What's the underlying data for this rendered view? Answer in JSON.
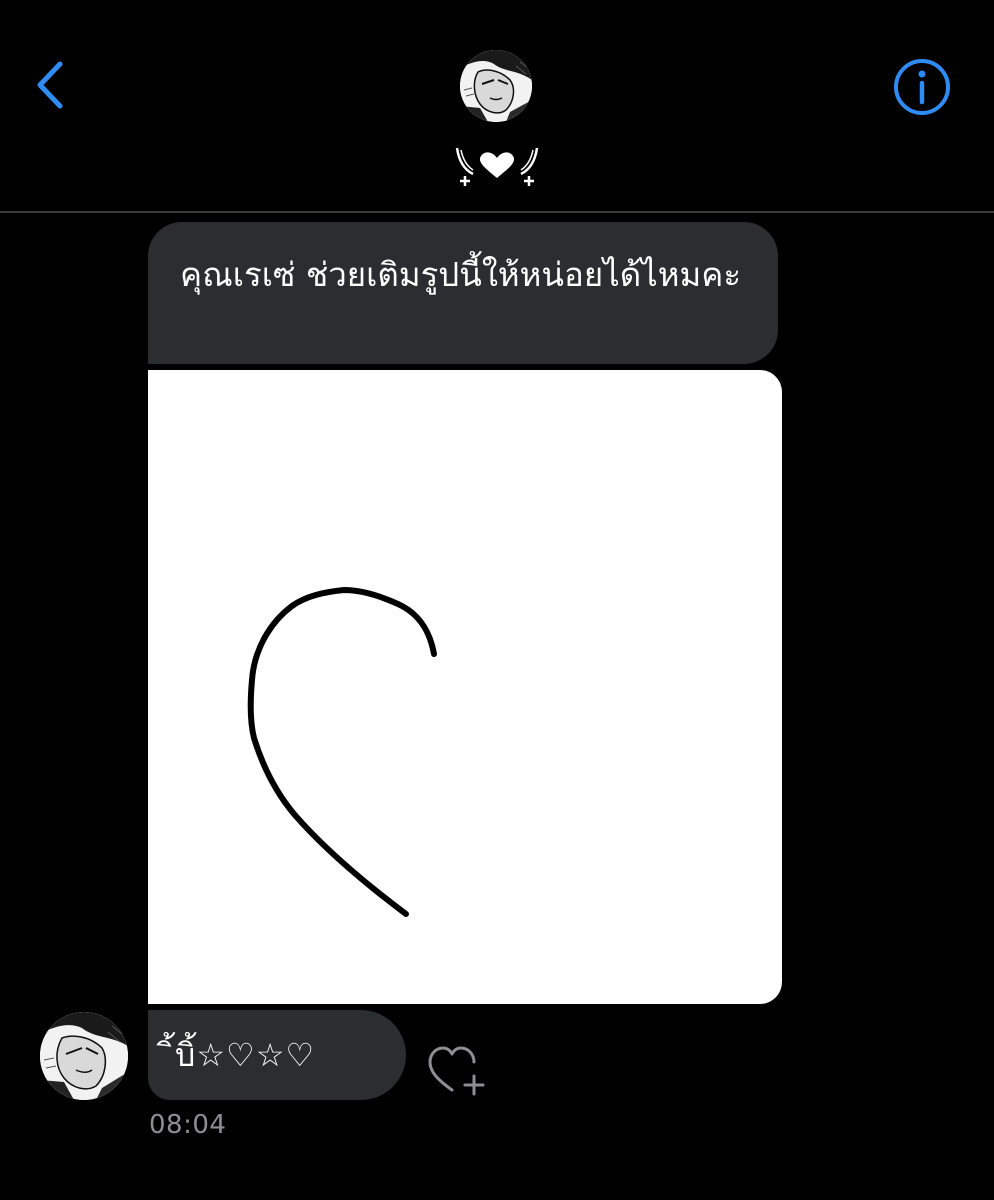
{
  "header": {
    "back_icon": "chevron-left-icon",
    "info_icon": "info-circle-icon",
    "contact_name_decoration": "𓍯❤︎𓍯",
    "accent_color": "#2f8cf5"
  },
  "messages": [
    {
      "type": "text",
      "text": "คุณเรเซ่ ช่วยเติมรูปนี้ให้หน่อยได้ไหมคะ"
    },
    {
      "type": "image",
      "description_icon": "half-heart-drawing"
    },
    {
      "type": "text",
      "text": "ิ้บิ้☆♡☆♡"
    }
  ],
  "react_icon": "heart-plus-icon",
  "timestamp": "08:04",
  "colors": {
    "background": "#000000",
    "bubble": "#2c2d30",
    "divider": "#3a3a3c",
    "timestamp": "#8e8e93"
  }
}
